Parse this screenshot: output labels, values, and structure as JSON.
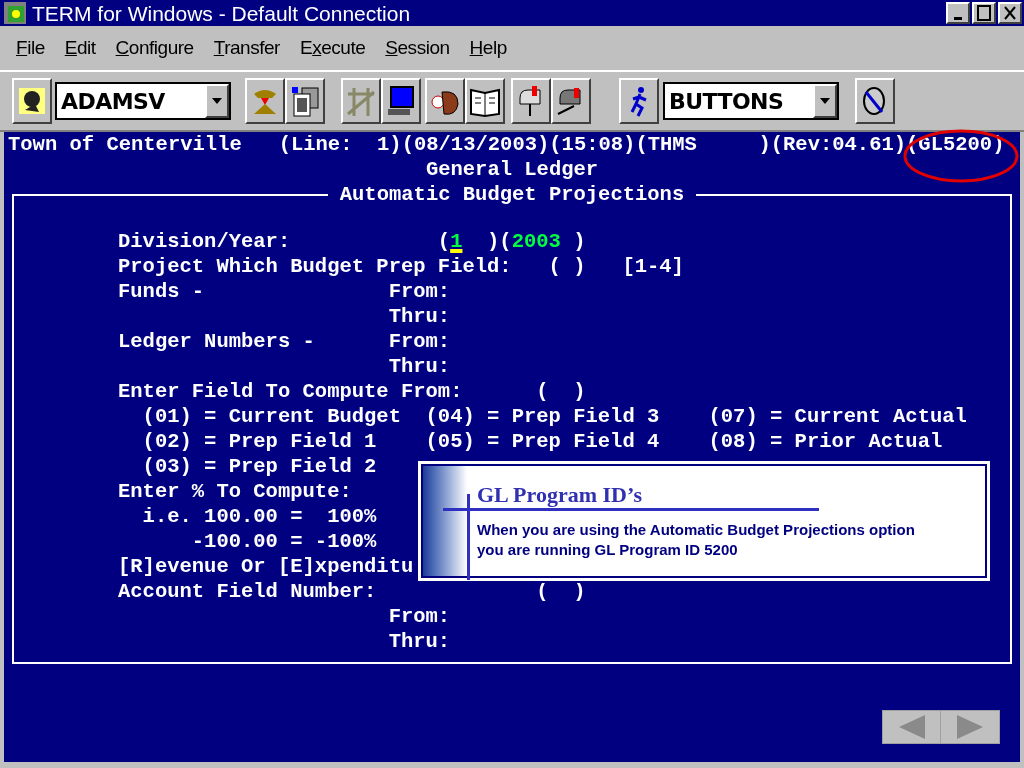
{
  "window": {
    "title": "TERM for Windows - Default Connection"
  },
  "menu": [
    {
      "key": "F",
      "post": "ile"
    },
    {
      "key": "E",
      "post": "dit"
    },
    {
      "key": "C",
      "post": "onfigure"
    },
    {
      "key": "T",
      "post": "ransfer"
    },
    {
      "pre": "E",
      "key": "x",
      "post": "ecute"
    },
    {
      "key": "S",
      "post": "ession"
    },
    {
      "key": "H",
      "post": "elp"
    }
  ],
  "toolbar": {
    "host_combo": {
      "value": "ADAMSV"
    },
    "buttons_combo": {
      "value": "BUTTONS"
    }
  },
  "terminal": {
    "status_line": "Town of Centerville   (Line:  1)(08/13/2003)(15:08)(THMS     )(Rev:04.61)(GL5200)",
    "heading": "General Ledger",
    "form_title": "Automatic Budget Projections",
    "lines": [
      [
        {
          "text": "Division/Year:            (",
          "kind": "label"
        },
        {
          "text": "1",
          "kind": "value",
          "cursor": true
        },
        {
          "text": "  )(",
          "kind": "label"
        },
        {
          "text": "2003",
          "kind": "value",
          "cursor": false
        },
        {
          "text": " )",
          "kind": "label"
        }
      ],
      [
        {
          "text": "Project Which Budget Prep Field:   ( )   [1-4]",
          "kind": "label"
        }
      ],
      [
        {
          "text": "Funds -               From:",
          "kind": "label"
        }
      ],
      [
        {
          "text": "                      Thru:",
          "kind": "label"
        }
      ],
      [
        {
          "text": "Ledger Numbers -      From:",
          "kind": "label"
        }
      ],
      [
        {
          "text": "                      Thru:",
          "kind": "label"
        }
      ],
      [
        {
          "text": "Enter Field To Compute From:      (  )",
          "kind": "label"
        }
      ],
      [
        {
          "text": "  (01) = Current Budget  (04) = Prep Field 3    (07) = Current Actual",
          "kind": "label"
        }
      ],
      [
        {
          "text": "  (02) = Prep Field 1    (05) = Prep Field 4    (08) = Prior Actual",
          "kind": "label"
        }
      ],
      [
        {
          "text": "  (03) = Prep Field 2",
          "kind": "label"
        }
      ],
      [
        {
          "text": "Enter % To Compute:",
          "kind": "label"
        }
      ],
      [
        {
          "text": "  i.e. 100.00 =  100%",
          "kind": "label"
        }
      ],
      [
        {
          "text": "      -100.00 = -100%",
          "kind": "label"
        }
      ],
      [
        {
          "text": "[R]evenue Or [E]xpenditu",
          "kind": "label"
        }
      ],
      [
        {
          "text": "Account Field Number:             (  )",
          "kind": "label"
        }
      ],
      [
        {
          "text": "                      From:",
          "kind": "label"
        }
      ],
      [
        {
          "text": "                      Thru:",
          "kind": "label"
        }
      ]
    ]
  },
  "callout": {
    "title": "GL Program ID’s",
    "body": "When you are using the Automatic Budget Projections option you are running GL Program ID 5200"
  }
}
